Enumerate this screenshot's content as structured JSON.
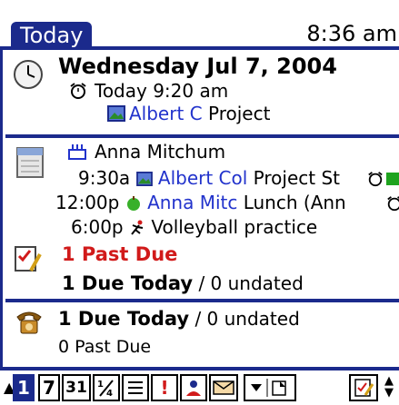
{
  "header": {
    "title": "Today",
    "clock": "8:36 am"
  },
  "date_section": {
    "date": "Wednesday Jul 7, 2004",
    "alarm": "Today 9:20 am",
    "alarm_subject": "Albert C",
    "alarm_subject_rest": "Project"
  },
  "calendar_section": {
    "birthday": "Anna Mitchum",
    "events": [
      {
        "time": "9:30a",
        "link": "Albert Col",
        "text": "Project St"
      },
      {
        "time": "12:00p",
        "link": "Anna Mitc",
        "text": "Lunch (Ann"
      },
      {
        "time": "6:00p",
        "link": "",
        "text": "Volleyball practice"
      }
    ]
  },
  "tasks_section": {
    "past_due": "1 Past Due",
    "due_today": "1 Due Today",
    "undated": "/ 0 undated"
  },
  "calls_section": {
    "due_today": "1 Due Today",
    "undated": "/ 0 undated",
    "past_due": "0 Past Due"
  },
  "toolbar": {
    "buttons": [
      "1",
      "7",
      "31"
    ]
  },
  "colors": {
    "accent": "#1b2a8c",
    "link": "#2233cc",
    "alert": "#d11a1a"
  }
}
